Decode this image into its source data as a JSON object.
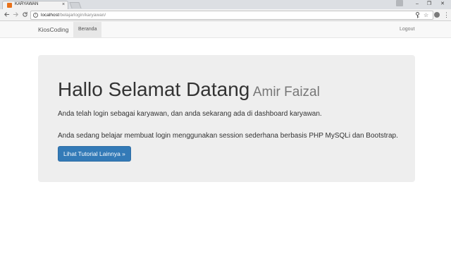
{
  "browser": {
    "tab_title": "KARYAWAN",
    "tab_close": "×",
    "url_host": "localhost",
    "url_path": "/belajarlogin/karyawan/",
    "window_controls": {
      "minimize": "–",
      "maximize": "❐",
      "close": "✕"
    },
    "nav_icons": {
      "back": "back-arrow-icon",
      "forward": "forward-arrow-icon",
      "reload": "reload-icon"
    },
    "omnibox_icons": {
      "info": "i",
      "key": "🔑",
      "star": "☆"
    },
    "menu": "⋮"
  },
  "navbar": {
    "brand": "KiosCoding",
    "active_item": "Beranda",
    "logout": "Logout"
  },
  "jumbotron": {
    "heading": "Hallo Selamat Datang",
    "heading_name": "Amir Faizal",
    "paragraph_1": "Anda telah login sebagai karyawan, dan anda sekarang ada di dashboard karyawan.",
    "paragraph_2": "Anda sedang belajar membuat login menggunakan session sederhana berbasis PHP MySQLi dan Bootstrap.",
    "button_label": "Lihat Tutorial Lainnya »"
  },
  "colors": {
    "primary": "#337ab7",
    "jumbotron_bg": "#eeeeee",
    "navbar_bg": "#f8f8f8"
  }
}
